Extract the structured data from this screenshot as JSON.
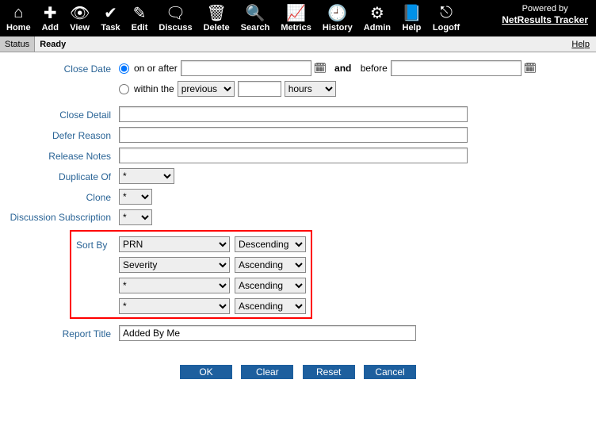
{
  "powered": {
    "text": "Powered by",
    "link": "NetResults Tracker"
  },
  "toolbar": [
    {
      "name": "home",
      "icon": "⌂",
      "label": "Home"
    },
    {
      "name": "add",
      "icon": "✚",
      "label": "Add"
    },
    {
      "name": "view",
      "icon": "👁",
      "label": "View"
    },
    {
      "name": "task",
      "icon": "✔",
      "label": "Task"
    },
    {
      "name": "edit",
      "icon": "✎",
      "label": "Edit"
    },
    {
      "name": "discuss",
      "icon": "🗨",
      "label": "Discuss"
    },
    {
      "name": "delete",
      "icon": "🗑",
      "label": "Delete"
    },
    {
      "name": "search",
      "icon": "🔍",
      "label": "Search"
    },
    {
      "name": "metrics",
      "icon": "📈",
      "label": "Metrics"
    },
    {
      "name": "history",
      "icon": "🕘",
      "label": "History"
    },
    {
      "name": "admin",
      "icon": "⚙",
      "label": "Admin"
    },
    {
      "name": "help",
      "icon": "📘",
      "label": "Help"
    },
    {
      "name": "logoff",
      "icon": "⎋",
      "label": "Logoff"
    }
  ],
  "status": {
    "label": "Status",
    "value": "Ready",
    "help": "Help"
  },
  "labels": {
    "close_date": "Close Date",
    "close_detail": "Close Detail",
    "defer_reason": "Defer Reason",
    "release_notes": "Release Notes",
    "duplicate_of": "Duplicate Of",
    "clone": "Clone",
    "discussion": "Discussion Subscription",
    "sort_by": "Sort By",
    "report_title": "Report Title"
  },
  "dateRadio": {
    "onAfter": "on or after",
    "andBefore": "and before",
    "withinThe": "within the"
  },
  "selects": {
    "star": "*",
    "previous": "previous",
    "hours": "hours"
  },
  "sort": [
    {
      "field": "PRN",
      "dir": "Descending"
    },
    {
      "field": "Severity",
      "dir": "Ascending"
    },
    {
      "field": "*",
      "dir": "Ascending"
    },
    {
      "field": "*",
      "dir": "Ascending"
    }
  ],
  "values": {
    "close_detail": "",
    "defer_reason": "",
    "release_notes": "",
    "report_title": "Added By Me"
  },
  "buttons": {
    "ok": "OK",
    "clear": "Clear",
    "reset": "Reset",
    "cancel": "Cancel"
  }
}
